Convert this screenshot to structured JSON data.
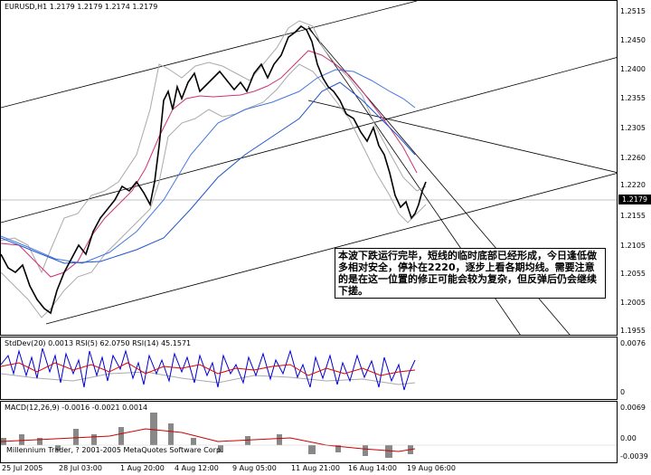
{
  "chart": {
    "header": "EURUSD,H1  1.2179 1.2179 1.2174 1.2179",
    "y_labels": [
      "1.2515",
      "1.2450",
      "1.2400",
      "1.2355",
      "1.2305",
      "1.2260",
      "1.2220",
      "1.2155",
      "1.2105",
      "1.2055",
      "1.2005",
      "1.1955"
    ],
    "current_price": "1.2179",
    "annotation": "本波下跌运行完毕，短线的临时底部已经形成，今日逢低做多相对安全，停补在2220，逐步上看各期均线。需要注意的是在这一位置的修正可能会较为复杂，但反弹后仍会继续下搓。"
  },
  "indicator1": {
    "header": "StdDev(20) 0.0013  RSI(5) 62.0750  RSI(14) 45.1571",
    "y_labels": [
      "0.0076",
      "0"
    ]
  },
  "indicator2": {
    "header": "MACD(12,26,9) -0.0016 -0.0021 0.0014",
    "copyright": "Millennium Trader, ? 2001-2005 MetaQuotes Software Corp.",
    "y_labels": [
      "0.0069",
      "0.00",
      "-0.0039"
    ]
  },
  "x_labels": [
    "25 Jul 2005",
    "28 Jul 03:00",
    "1 Aug 20:00",
    "4 Aug 12:00",
    "9 Aug 05:00",
    "11 Aug 21:00",
    "16 Aug 14:00",
    "19 Aug 06:00"
  ],
  "colors": {
    "ma_fast": "#cc3377",
    "ma_slow1": "#4477dd",
    "ma_slow2": "#2255cc",
    "bands": "#aaaaaa",
    "rsi_red": "#dd0000",
    "rsi_blue": "#0000cc",
    "macd_hist": "#888888",
    "macd_signal": "#cc0000"
  }
}
